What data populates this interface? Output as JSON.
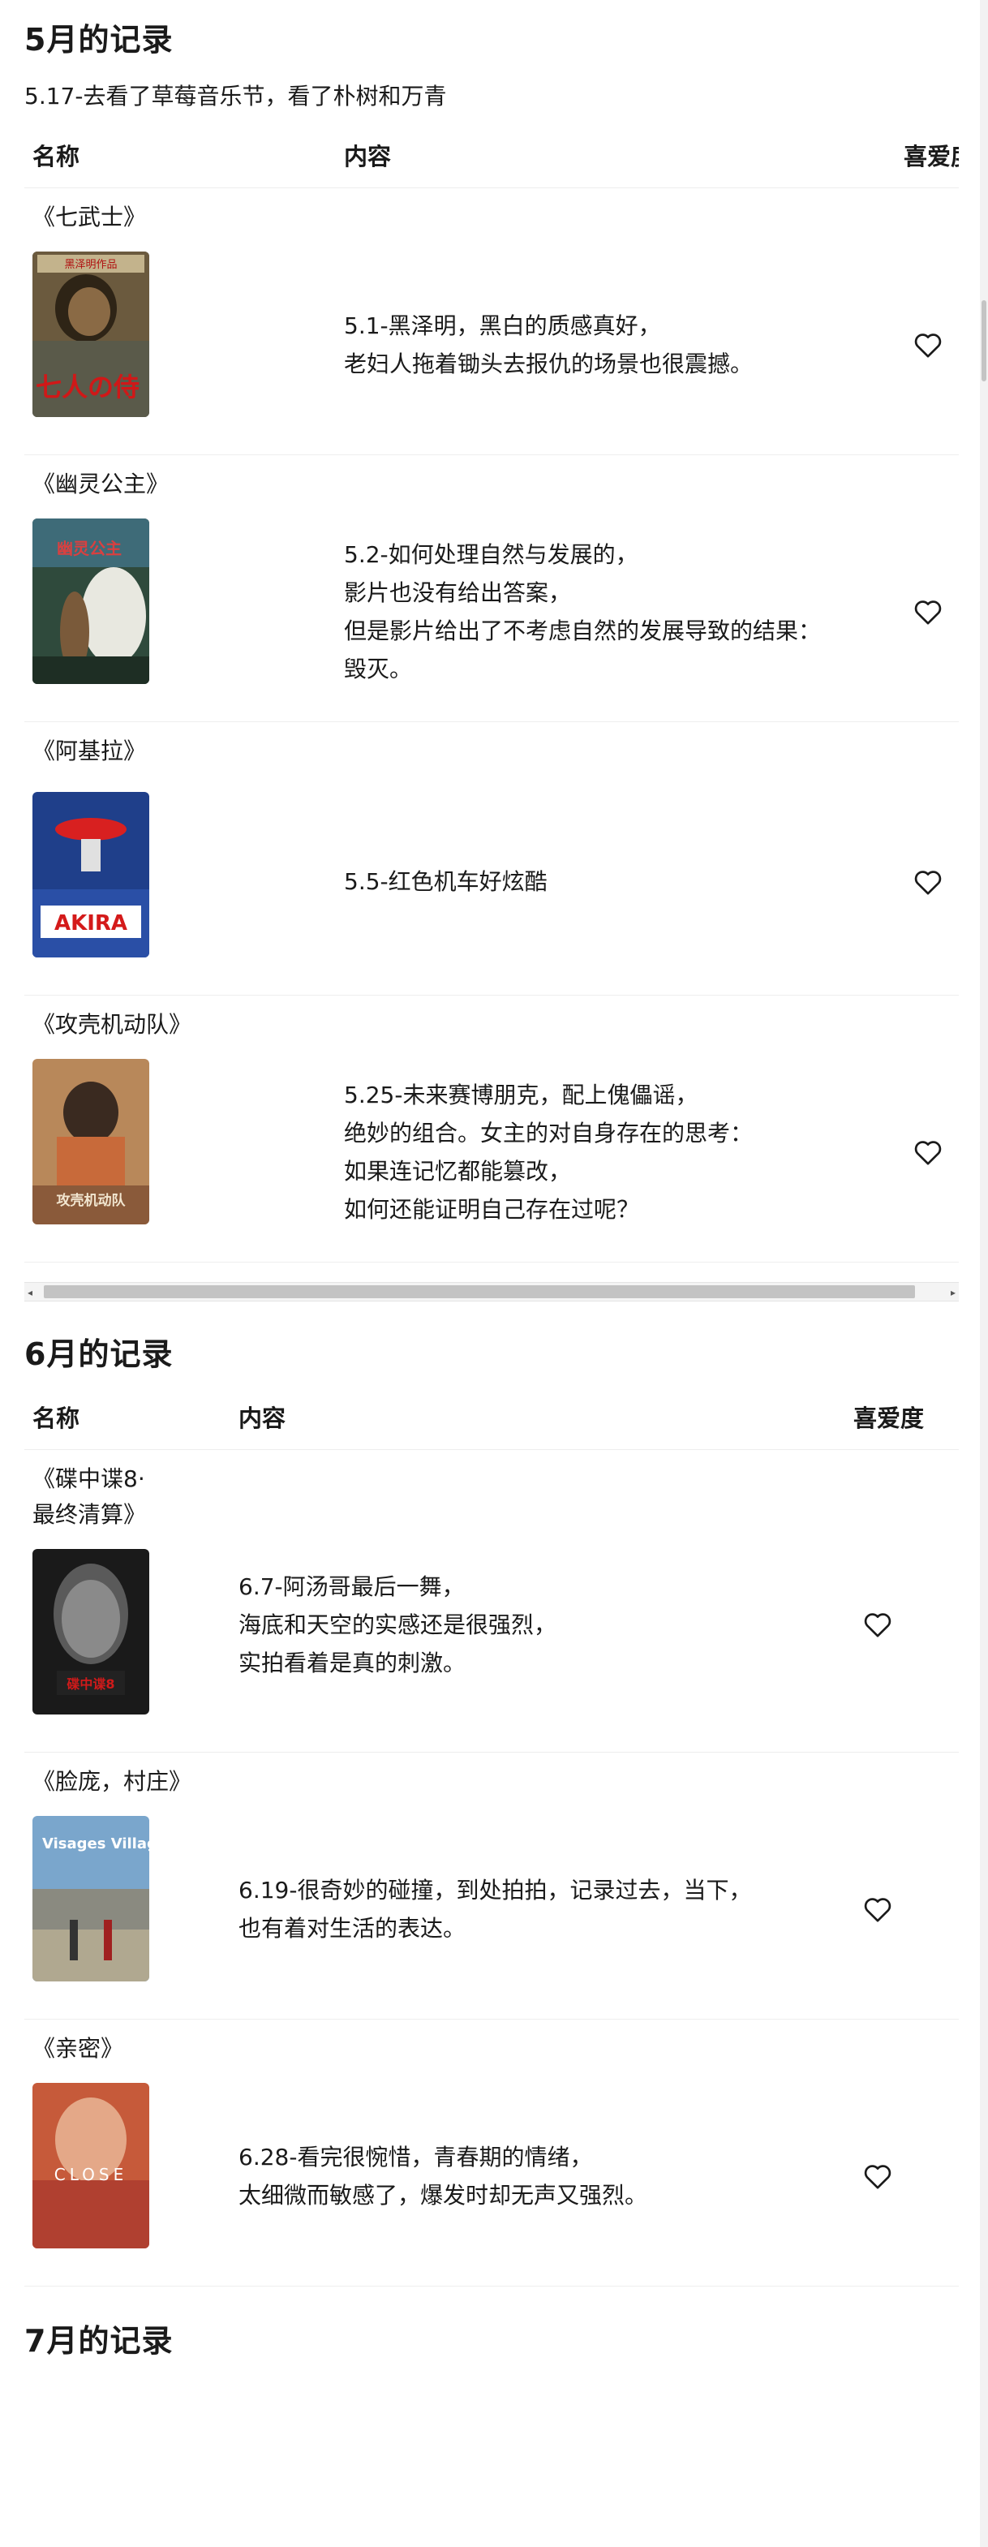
{
  "months": {
    "may": {
      "title": "5月的记录",
      "note": "5.17-去看了草莓音乐节，看了朴树和万青",
      "headers": {
        "name": "名称",
        "content": "内容",
        "like": "喜爱度"
      },
      "rows": [
        {
          "title": "《七武士》",
          "content": "5.1-黑泽明，黑白的质感真好，\n老妇人拖着锄头去报仇的场景也很震撼。",
          "liked": false
        },
        {
          "title": "《幽灵公主》",
          "content": "5.2-如何处理自然与发展的，\n影片也没有给出答案，\n但是影片给出了不考虑自然的发展导致的结果：\n毁灭。",
          "liked": false
        },
        {
          "title": "《阿基拉》",
          "content": "5.5-红色机车好炫酷",
          "liked": false
        },
        {
          "title": "《攻壳机动队》",
          "content": "5.25-未来赛博朋克，配上傀儡谣，\n绝妙的组合。女主的对自身存在的思考：\n如果连记忆都能篡改，\n如何还能证明自己存在过呢？",
          "liked": false
        }
      ]
    },
    "june": {
      "title": "6月的记录",
      "headers": {
        "name": "名称",
        "content": "内容",
        "like": "喜爱度"
      },
      "rows": [
        {
          "title": "《碟中谍8·\n最终清算》",
          "content": "6.7-阿汤哥最后一舞，\n海底和天空的实感还是很强烈，\n实拍看着是真的刺激。",
          "liked": false
        },
        {
          "title": "《脸庞，村庄》",
          "content": "6.19-很奇妙的碰撞，到处拍拍，记录过去，当下，\n也有着对生活的表达。",
          "liked": false
        },
        {
          "title": "《亲密》",
          "content": "6.28-看完很惋惜，青春期的情绪，\n太细微而敏感了，爆发时却无声又强烈。",
          "liked": false
        }
      ]
    },
    "july": {
      "title": "7月的记录"
    }
  },
  "posters": {
    "p1": {
      "caption": "七人の侍",
      "top": "黑泽明作品"
    },
    "p2": {
      "caption": "幽灵公主"
    },
    "p3": {
      "caption": "AKIRA"
    },
    "p4": {
      "caption": "攻壳机动队"
    },
    "p5": {
      "caption": "碟中谍8"
    },
    "p6": {
      "caption": "Visages Villages"
    },
    "p7": {
      "caption": "CLOSE"
    }
  },
  "icons": {
    "heart": "heart-outline-icon"
  },
  "colors": {
    "text": "#1a1a1a",
    "divider": "#eeeeee",
    "scrollbar": "#c3c3c3"
  }
}
